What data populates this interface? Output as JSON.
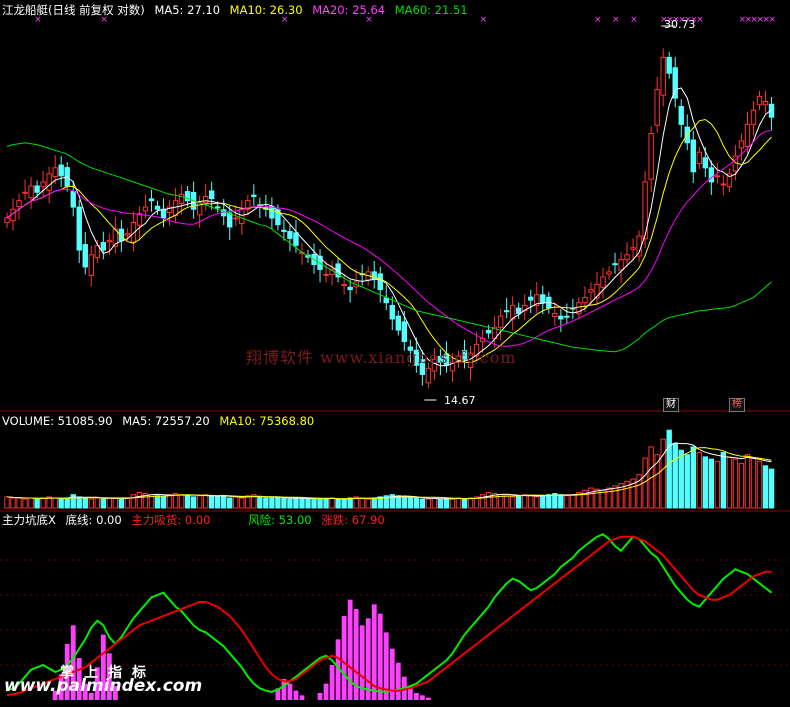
{
  "header": {
    "title": "江龙船艇(日线 前复权 对数)",
    "ma5": "MA5: 27.10",
    "ma10": "MA10: 26.30",
    "ma20": "MA20: 25.64",
    "ma60": "MA60: 21.51"
  },
  "price_panel": {
    "high_label": "30.73",
    "low_label": "14.67",
    "tag_cai": "财",
    "tag_bang": "榜"
  },
  "volume_header": {
    "volume": "VOLUME: 51085.90",
    "ma5": "MA5: 72557.20",
    "ma10": "MA10: 75368.80"
  },
  "indicator_header": {
    "name": "主力坑底X",
    "dixian": "底线: 0.00",
    "zhuli": "主力吸货: 0.00",
    "fengxian": "风险: 53.00",
    "zhangdie": "涨跌: 67.90"
  },
  "watermark": "翔博软件 www.xiangbosoft.com",
  "brand": {
    "cn": "掌上指标",
    "url": "www.palmindex.com"
  },
  "colors": {
    "up": "#ff3232",
    "down": "#54ffff",
    "ma5": "#ffffff",
    "ma10": "#ffff00",
    "ma20": "#ff00ff",
    "ma60": "#00e000",
    "risk": "#00ee00",
    "rise": "#ee0000",
    "bars": "#ff40ff"
  },
  "chart_data": [
    {
      "type": "candlestick",
      "title": "江龙船艇(日线 前复权 对数)",
      "y_scale": "log",
      "ylim": [
        14,
        32
      ],
      "x_count": 128,
      "series_labels": [
        "MA5",
        "MA10",
        "MA20",
        "MA60"
      ],
      "annotations": [
        {
          "text": "30.73",
          "type": "max",
          "x": 108,
          "value": 30.73
        },
        {
          "text": "14.67",
          "type": "min",
          "x": 69,
          "value": 14.67
        }
      ],
      "close": [
        20.8,
        21.2,
        21.6,
        22.0,
        22.3,
        22.0,
        22.5,
        22.9,
        23.2,
        22.8,
        22.3,
        21.3,
        19.4,
        18.7,
        19.2,
        19.6,
        19.4,
        19.8,
        20.3,
        19.8,
        20.1,
        20.6,
        21.0,
        21.3,
        21.6,
        21.2,
        20.8,
        21.3,
        21.6,
        21.9,
        21.6,
        21.2,
        21.5,
        21.8,
        21.7,
        21.3,
        20.9,
        20.4,
        20.8,
        21.2,
        21.6,
        21.8,
        21.4,
        21.2,
        20.8,
        20.5,
        20.2,
        19.9,
        19.6,
        19.3,
        19.1,
        18.8,
        18.6,
        18.4,
        18.6,
        18.3,
        18.0,
        17.8,
        18.1,
        18.4,
        18.5,
        18.2,
        17.8,
        17.3,
        16.7,
        16.3,
        15.9,
        15.6,
        15.1,
        14.8,
        15.0,
        15.3,
        15.2,
        15.1,
        15.2,
        15.4,
        15.3,
        15.5,
        15.8,
        16.0,
        16.2,
        16.4,
        16.8,
        17.0,
        17.2,
        16.9,
        17.2,
        17.4,
        17.6,
        17.3,
        17.1,
        16.9,
        16.7,
        16.8,
        17.1,
        17.3,
        17.5,
        17.8,
        18.0,
        18.3,
        18.5,
        18.8,
        19.0,
        19.2,
        19.5,
        20.0,
        22.5,
        25.0,
        27.5,
        29.5,
        28.5,
        27.0,
        25.5,
        24.5,
        23.0,
        24.0,
        23.2,
        22.5,
        22.8,
        22.4,
        22.9,
        23.8,
        24.6,
        25.5,
        26.3,
        27.1,
        26.8,
        25.9
      ],
      "ma60": [
        24.3,
        24.4,
        24.45,
        24.5,
        24.45,
        24.4,
        24.3,
        24.2,
        24.1,
        24.0,
        23.9,
        23.7,
        23.5,
        23.35,
        23.2,
        23.1,
        23.0,
        22.9,
        22.8,
        22.7,
        22.6,
        22.5,
        22.4,
        22.3,
        22.2,
        22.1,
        22.0,
        21.9,
        21.85,
        21.8,
        21.7,
        21.6,
        21.5,
        21.4,
        21.3,
        21.2,
        21.1,
        21.0,
        20.9,
        20.8,
        20.7,
        20.6,
        20.5,
        20.45,
        20.3,
        20.1,
        19.9,
        19.7,
        19.5,
        19.3,
        19.15,
        19.0,
        18.85,
        18.7,
        18.55,
        18.4,
        18.25,
        18.1,
        18.0,
        17.9,
        17.8,
        17.7,
        17.6,
        17.5,
        17.4,
        17.3,
        17.2,
        17.1,
        17.0,
        16.95,
        16.9,
        16.85,
        16.8,
        16.75,
        16.7,
        16.65,
        16.6,
        16.55,
        16.5,
        16.45,
        16.4,
        16.35,
        16.3,
        16.25,
        16.2,
        16.15,
        16.1,
        16.05,
        16.0,
        15.95,
        15.9,
        15.85,
        15.8,
        15.75,
        15.7,
        15.68,
        15.65,
        15.63,
        15.6,
        15.58,
        15.56,
        15.55,
        15.6,
        15.7,
        15.85,
        16.0,
        16.2,
        16.35,
        16.5,
        16.65,
        16.75,
        16.8,
        16.85,
        16.9,
        16.95,
        17.0,
        17.02,
        17.05,
        17.08,
        17.1,
        17.12,
        17.2,
        17.3,
        17.4,
        17.5,
        17.7,
        17.9,
        18.1
      ]
    },
    {
      "type": "bar",
      "title": "VOLUME",
      "series_labels": [
        "MA5",
        "MA10"
      ],
      "values": [
        10,
        9,
        9,
        8,
        9,
        8,
        9,
        10,
        9,
        8,
        9,
        12,
        10,
        9,
        8,
        9,
        8,
        9,
        9,
        8,
        9,
        12,
        14,
        13,
        12,
        11,
        10,
        12,
        13,
        12,
        11,
        10,
        11,
        12,
        11,
        10,
        11,
        9,
        10,
        9,
        11,
        12,
        10,
        9,
        9,
        10,
        9,
        8,
        9,
        8,
        9,
        9,
        8,
        8,
        9,
        8,
        8,
        9,
        10,
        9,
        8,
        9,
        10,
        11,
        12,
        11,
        10,
        9,
        9,
        8,
        8,
        9,
        8,
        9,
        8,
        9,
        8,
        9,
        10,
        12,
        14,
        13,
        12,
        11,
        10,
        11,
        12,
        11,
        10,
        11,
        12,
        13,
        12,
        11,
        12,
        14,
        16,
        18,
        17,
        16,
        18,
        20,
        22,
        24,
        26,
        30,
        45,
        55,
        48,
        62,
        70,
        58,
        52,
        48,
        55,
        50,
        46,
        44,
        42,
        50,
        46,
        44,
        40,
        48,
        45,
        42,
        38,
        35
      ]
    },
    {
      "type": "line",
      "title": "主力坑底X",
      "series_labels": [
        "风险",
        "涨跌"
      ],
      "values_risk": [
        8,
        10,
        14,
        20,
        26,
        28,
        30,
        27,
        24,
        26,
        30,
        36,
        44,
        52,
        62,
        68,
        64,
        54,
        48,
        54,
        62,
        70,
        76,
        82,
        88,
        90,
        92,
        86,
        80,
        76,
        70,
        64,
        60,
        58,
        54,
        50,
        46,
        40,
        34,
        28,
        20,
        14,
        10,
        8,
        7,
        9,
        12,
        16,
        20,
        24,
        28,
        32,
        36,
        38,
        34,
        28,
        22,
        16,
        12,
        10,
        9,
        8,
        7,
        7,
        8,
        9,
        10,
        12,
        14,
        18,
        22,
        26,
        30,
        34,
        40,
        48,
        56,
        62,
        68,
        74,
        80,
        88,
        94,
        100,
        104,
        102,
        98,
        94,
        96,
        100,
        104,
        108,
        114,
        118,
        122,
        128,
        132,
        136,
        140,
        142,
        138,
        132,
        128,
        134,
        140,
        138,
        132,
        126,
        122,
        114,
        106,
        98,
        92,
        86,
        82,
        80,
        86,
        92,
        98,
        104,
        108,
        112,
        110,
        108,
        104,
        100,
        96,
        92
      ],
      "values_rise": [
        4,
        5,
        6,
        8,
        10,
        12,
        14,
        16,
        18,
        20,
        22,
        24,
        26,
        28,
        32,
        36,
        40,
        44,
        48,
        52,
        56,
        60,
        64,
        66,
        68,
        70,
        72,
        74,
        76,
        78,
        80,
        82,
        84,
        84,
        82,
        80,
        76,
        72,
        66,
        60,
        52,
        44,
        36,
        28,
        22,
        18,
        16,
        16,
        18,
        22,
        26,
        30,
        34,
        36,
        38,
        36,
        32,
        28,
        24,
        20,
        16,
        12,
        10,
        9,
        8,
        8,
        9,
        10,
        12,
        14,
        16,
        20,
        24,
        28,
        32,
        36,
        40,
        44,
        48,
        52,
        56,
        60,
        64,
        68,
        72,
        76,
        80,
        84,
        88,
        92,
        96,
        100,
        104,
        108,
        112,
        116,
        120,
        124,
        128,
        132,
        136,
        138,
        140,
        140,
        140,
        138,
        136,
        132,
        128,
        124,
        118,
        112,
        106,
        100,
        94,
        90,
        88,
        86,
        86,
        88,
        90,
        94,
        98,
        102,
        106,
        108,
        110,
        110
      ],
      "values_bars": [
        0,
        0,
        0,
        0,
        0,
        0,
        0,
        0,
        8,
        22,
        48,
        64,
        36,
        14,
        6,
        28,
        56,
        40,
        12,
        0,
        0,
        0,
        0,
        0,
        0,
        0,
        0,
        0,
        0,
        0,
        0,
        0,
        0,
        0,
        0,
        0,
        0,
        0,
        0,
        0,
        0,
        0,
        0,
        0,
        0,
        10,
        18,
        14,
        8,
        4,
        0,
        0,
        6,
        14,
        30,
        52,
        72,
        86,
        78,
        64,
        70,
        82,
        74,
        58,
        44,
        32,
        20,
        12,
        6,
        4,
        2,
        0,
        0,
        0,
        0,
        0,
        0,
        0,
        0,
        0,
        0,
        0,
        0,
        0,
        0,
        0,
        0,
        0,
        0,
        0,
        0,
        0,
        0,
        0,
        0,
        0,
        0,
        0,
        0,
        0,
        0,
        0,
        0,
        0,
        0,
        0,
        0,
        0,
        0,
        0,
        0,
        0,
        0,
        0,
        0,
        0,
        0,
        0,
        0,
        0,
        0,
        0,
        0,
        0,
        0,
        0,
        0,
        0
      ]
    }
  ]
}
